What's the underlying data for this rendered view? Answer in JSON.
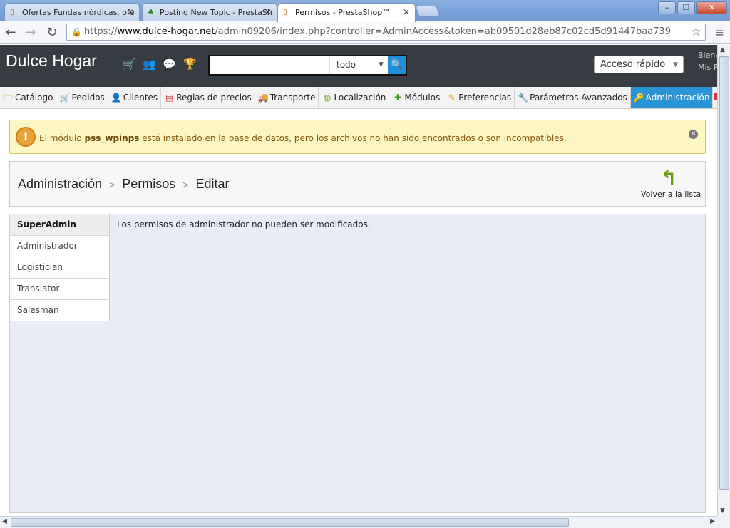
{
  "browser": {
    "tabs": [
      {
        "title": "Ofertas Fundas nórdicas, ofe",
        "active": false
      },
      {
        "title": "Posting New Topic - PrestaSh",
        "active": false
      },
      {
        "title": "Permisos - PrestaShop™",
        "active": true
      }
    ],
    "url_prefix": "https://",
    "url_host": "www.dulce-hogar.net",
    "url_path": "/admin09206/index.php?controller=AdminAccess&token=ab09501d28eb87c02cd5d91447baa739"
  },
  "header": {
    "brand": "Dulce Hogar",
    "icons": [
      "cart-icon",
      "user-icon",
      "chat-icon",
      "trophy-icon"
    ],
    "search": {
      "value": "",
      "scope": "todo"
    },
    "quick_access": "Acceso rápido",
    "user_line1": "Bienv",
    "user_line2": "Mis P"
  },
  "menu": [
    {
      "label": "Catálogo",
      "icon": "folder-icon"
    },
    {
      "label": "Pedidos",
      "icon": "cart-icon"
    },
    {
      "label": "Clientes",
      "icon": "user-icon"
    },
    {
      "label": "Reglas de precios",
      "icon": "price-rule-icon"
    },
    {
      "label": "Transporte",
      "icon": "truck-icon"
    },
    {
      "label": "Localización",
      "icon": "globe-icon"
    },
    {
      "label": "Módulos",
      "icon": "puzzle-icon"
    },
    {
      "label": "Preferencias",
      "icon": "edit-icon"
    },
    {
      "label": "Parámetros Avanzados",
      "icon": "wrench-icon"
    },
    {
      "label": "Administración",
      "icon": "key-icon",
      "active": true
    }
  ],
  "warning": {
    "prefix": "El módulo ",
    "module": "pss_wpinps",
    "suffix": " está instalado en la base de datos, pero los archivos no han sido encontrados o son incompatibles."
  },
  "breadcrumb": [
    "Administración",
    "Permisos",
    "Editar"
  ],
  "back_label": "Volver a la lista",
  "profiles": [
    "SuperAdmin",
    "Administrador",
    "Logistician",
    "Translator",
    "Salesman"
  ],
  "selected_profile": "SuperAdmin",
  "permission_message": "Los permisos de administrador no pueden ser modificados.",
  "colors": {
    "header_bg": "#373c42",
    "active_menu": "#2a95d6",
    "warning_bg": "#fcf6c3"
  }
}
